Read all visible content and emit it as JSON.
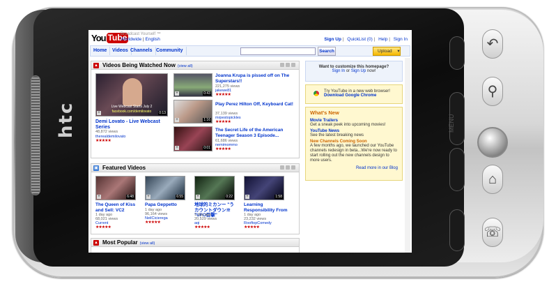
{
  "device": {
    "brand": "htc",
    "menu_label": "MENU"
  },
  "header": {
    "tagline": "Broadcast Yourself ™",
    "region": [
      "Worldwide",
      "English"
    ],
    "links": [
      "Sign Up",
      "QuickList (0)",
      "Help",
      "Sign In"
    ]
  },
  "nav": {
    "tabs": [
      "Home",
      "Videos",
      "Channels",
      "Community"
    ],
    "search_value": "",
    "search_label": "Search",
    "upload_label": "Upload"
  },
  "watched": {
    "title": "Videos Being Watched Now",
    "view_all": "(view all)",
    "feature": {
      "overlay1": "Live Webcast Starts July 2",
      "overlay2": "facebook.com/demilovato",
      "duration": "0:13",
      "title": "Demi Lovato - Live Webcast Series",
      "views": "48,872 views",
      "user": "therealdemilovato"
    },
    "items": [
      {
        "title": "Joanna Krupa is pissed off on The Superstars!!",
        "views": "221,275 views",
        "user": "jakewe81",
        "duration": "0:43"
      },
      {
        "title": "Play Perez Hilton Off, Keyboard Cat!",
        "views": "37,139 views",
        "user": "mrpestopickles",
        "duration": "1:16"
      },
      {
        "title": "The Secret Life of the American Teenager Season 3 Episode...",
        "views": "61,686 views",
        "user": "nemimommo",
        "duration": "0:01"
      }
    ]
  },
  "featured": {
    "title": "Featured Videos",
    "items": [
      {
        "title": "The Queen of Kiss and Sell: VC2",
        "age": "1 day ago",
        "views": "68,021 views",
        "user": "Current",
        "duration": "6:48"
      },
      {
        "title": "Papa Geppetto",
        "age": "1 day ago",
        "views": "96,164 views",
        "user": "NeilCicierega",
        "duration": "6:55"
      },
      {
        "title": "地球的ミカンー \"うカウントダウン※ \"UFO目撃\"",
        "age": "1 day ago",
        "views": "20,529 views",
        "user": "aqi",
        "duration": "0:22"
      },
      {
        "title": "Learning Responsibility From",
        "age": "1 day ago",
        "views": "23,232 views",
        "user": "RooftopComedy",
        "duration": "1:58"
      }
    ]
  },
  "popular": {
    "title": "Most Popular",
    "view_all": "(view all)"
  },
  "sidebar": {
    "customize": {
      "line1": "Want to customize this homepage?",
      "sign_in": "Sign In",
      "or": "or",
      "sign_up": "Sign Up",
      "now": "now!"
    },
    "chrome": {
      "line1": "Try YouTube in a new web browser!",
      "link": "Download Google Chrome"
    },
    "whats_new": {
      "title": "What's New",
      "items": [
        {
          "title": "Movie Trailers",
          "text": "Get a sneak peek into upcoming movies!"
        },
        {
          "title": "YouTube News",
          "text": "See the latest breaking news"
        },
        {
          "title": "New Channels Coming Soon",
          "text": "A few months ago, we launched our YouTube channels redesign in beta...We're now ready to start rolling out the new channels design to more users."
        }
      ],
      "more": "Read more in our Blog"
    }
  },
  "colors": {
    "accent": "#03c",
    "brand": "#cc0000",
    "upload": "#f5b700"
  }
}
